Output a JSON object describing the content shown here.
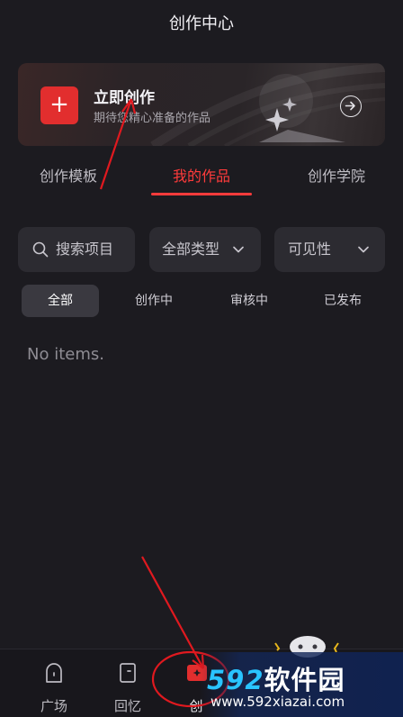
{
  "header": {
    "title": "创作中心"
  },
  "create_card": {
    "title": "立即创作",
    "subtitle": "期待您精心准备的作品",
    "plus_icon": "plus-icon",
    "arrow_icon": "arrow-right-circle-icon",
    "accent_color": "#e22e2e"
  },
  "tabs": [
    {
      "label": "创作模板",
      "active": false
    },
    {
      "label": "我的作品",
      "active": true
    },
    {
      "label": "创作学院",
      "active": false
    }
  ],
  "filters": {
    "search_placeholder": "搜索项目",
    "type_label": "全部类型",
    "visibility_label": "可见性"
  },
  "status_tabs": [
    {
      "label": "全部",
      "active": true
    },
    {
      "label": "创作中",
      "active": false
    },
    {
      "label": "审核中",
      "active": false
    },
    {
      "label": "已发布",
      "active": false
    }
  ],
  "empty_text": "No items.",
  "bottom_nav": [
    {
      "label": "广场",
      "icon": "plaza-icon"
    },
    {
      "label": "回忆",
      "icon": "memory-icon"
    },
    {
      "label": "创",
      "icon": "create-icon",
      "active": true
    }
  ],
  "watermark": {
    "brand_num": "592",
    "brand_text": "软件园",
    "url": "www.592xiazai.com"
  },
  "colors": {
    "background": "#1c1b20",
    "accent": "#ff3b3b",
    "annotation": "#e0191f"
  }
}
